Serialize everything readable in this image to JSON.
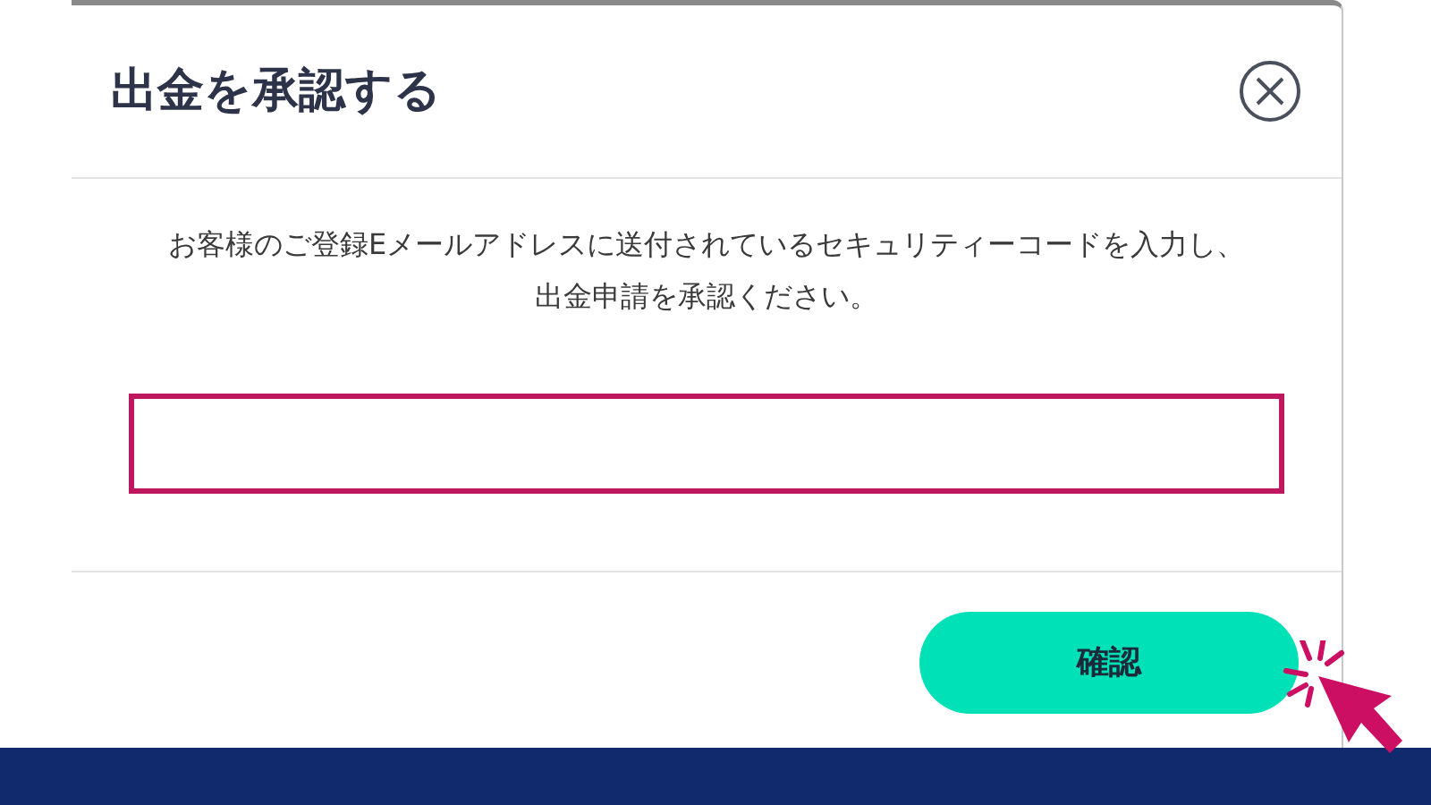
{
  "dialog": {
    "title": "出金を承認する",
    "message": "お客様のご登録Eメールアドレスに送付されているセキュリティーコードを入力し、出金申請を承認ください。",
    "confirm_button": "確認"
  }
}
